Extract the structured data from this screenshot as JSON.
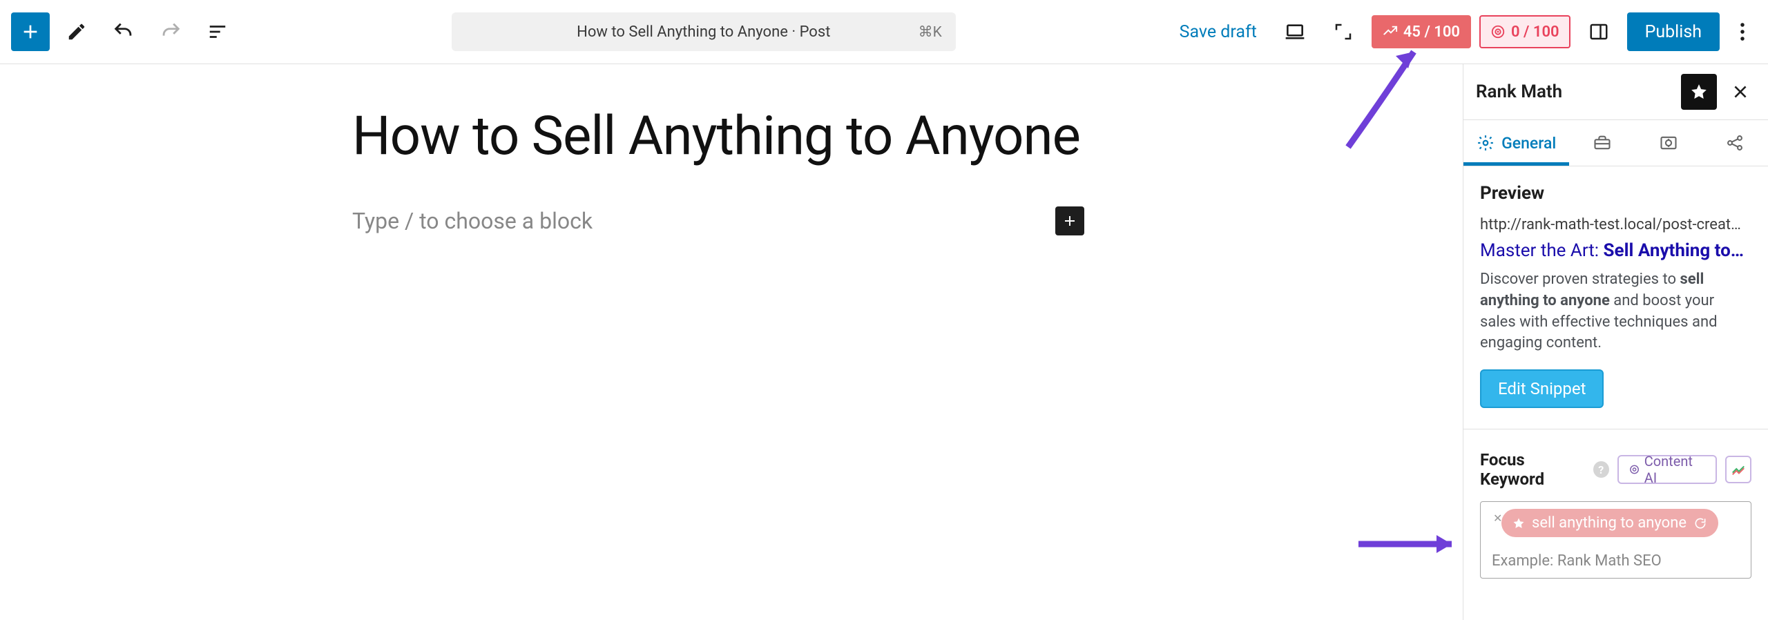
{
  "topbar": {
    "doc_title": "How to Sell Anything to Anyone · Post",
    "kbd": "⌘K",
    "save_draft": "Save draft",
    "seo_score": "45 / 100",
    "ai_score": "0 / 100",
    "publish": "Publish"
  },
  "editor": {
    "title": "How to Sell Anything to Anyone",
    "block_prompt": "Type / to choose a block"
  },
  "sidebar": {
    "panel_title": "Rank Math",
    "tabs": {
      "general": "General"
    },
    "preview": {
      "heading": "Preview",
      "url": "http://rank-math-test.local/post-creat…",
      "title_plain": "Master the Art: ",
      "title_bold": "Sell Anything to…",
      "desc_pre": "Discover proven strategies to ",
      "desc_bold": "sell anything to anyone",
      "desc_post": " and boost your sales with effective techniques and engaging content.",
      "edit_snippet": "Edit Snippet"
    },
    "focus_keyword": {
      "label": "Focus Keyword",
      "content_ai": "Content AI",
      "chip": "sell anything to anyone",
      "placeholder": "Example: Rank Math SEO"
    }
  }
}
